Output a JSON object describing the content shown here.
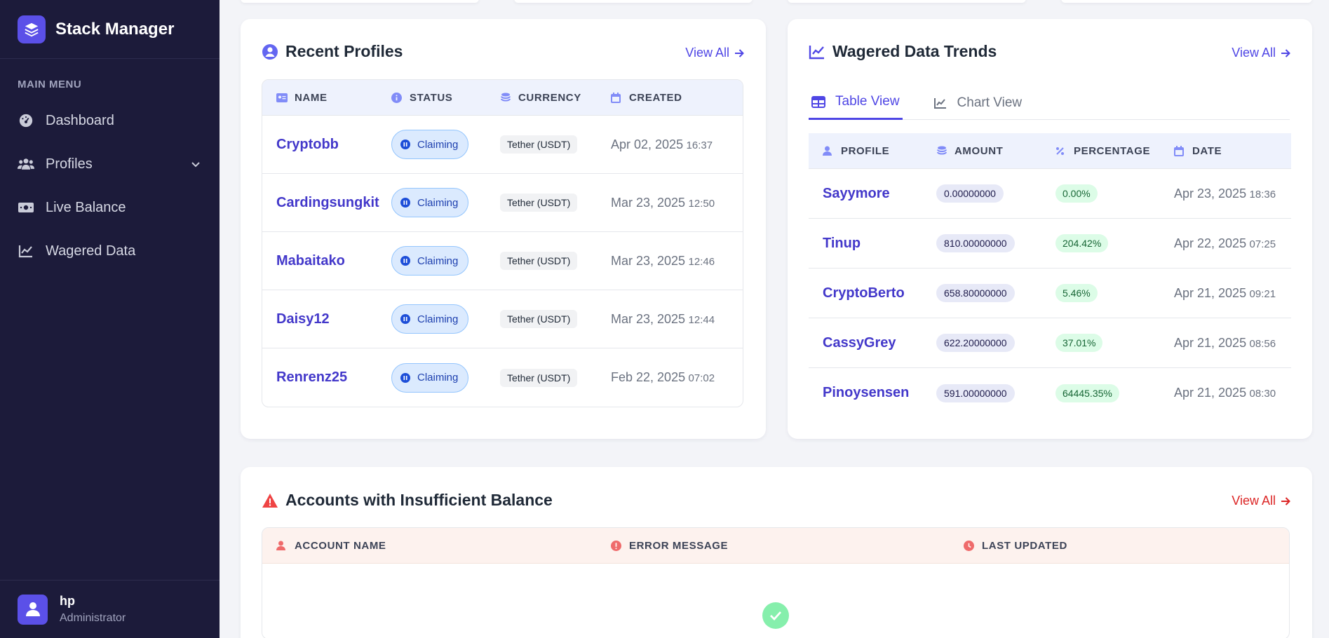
{
  "app": {
    "name": "Stack Manager"
  },
  "sidebar": {
    "menu_heading": "MAIN MENU",
    "items": [
      {
        "label": "Dashboard",
        "icon": "gauge-icon"
      },
      {
        "label": "Profiles",
        "icon": "users-icon"
      },
      {
        "label": "Live Balance",
        "icon": "money-bill-icon"
      },
      {
        "label": "Wagered Data",
        "icon": "chart-line-icon"
      }
    ],
    "user": {
      "name": "hp",
      "role": "Administrator"
    }
  },
  "recent_profiles": {
    "title": "Recent Profiles",
    "view_all": "View All",
    "columns": [
      "NAME",
      "STATUS",
      "CURRENCY",
      "CREATED"
    ],
    "rows": [
      {
        "name": "Cryptobb",
        "status": "Claiming",
        "currency": "Tether (USDT)",
        "date": "Apr 02, 2025",
        "time": "16:37"
      },
      {
        "name": "Cardingsungkit",
        "status": "Claiming",
        "currency": "Tether (USDT)",
        "date": "Mar 23, 2025",
        "time": "12:50"
      },
      {
        "name": "Mabaitako",
        "status": "Claiming",
        "currency": "Tether (USDT)",
        "date": "Mar 23, 2025",
        "time": "12:46"
      },
      {
        "name": "Daisy12",
        "status": "Claiming",
        "currency": "Tether (USDT)",
        "date": "Mar 23, 2025",
        "time": "12:44"
      },
      {
        "name": "Renrenz25",
        "status": "Claiming",
        "currency": "Tether (USDT)",
        "date": "Feb 22, 2025",
        "time": "07:02"
      }
    ]
  },
  "wagered": {
    "title": "Wagered Data Trends",
    "view_all": "View All",
    "tabs": [
      "Table View",
      "Chart View"
    ],
    "active_tab": "Table View",
    "columns": [
      "PROFILE",
      "AMOUNT",
      "PERCENTAGE",
      "DATE"
    ],
    "rows": [
      {
        "profile": "Sayymore",
        "amount": "0.00000000",
        "percentage": "0.00%",
        "date": "Apr 23, 2025",
        "time": "18:36"
      },
      {
        "profile": "Tinup",
        "amount": "810.00000000",
        "percentage": "204.42%",
        "date": "Apr 22, 2025",
        "time": "07:25"
      },
      {
        "profile": "CryptoBerto",
        "amount": "658.80000000",
        "percentage": "5.46%",
        "date": "Apr 21, 2025",
        "time": "09:21"
      },
      {
        "profile": "CassyGrey",
        "amount": "622.20000000",
        "percentage": "37.01%",
        "date": "Apr 21, 2025",
        "time": "08:56"
      },
      {
        "profile": "Pinoysensen",
        "amount": "591.00000000",
        "percentage": "64445.35%",
        "date": "Apr 21, 2025",
        "time": "08:30"
      }
    ]
  },
  "insufficient": {
    "title": "Accounts with Insufficient Balance",
    "view_all": "View All",
    "columns": [
      "ACCOUNT NAME",
      "ERROR MESSAGE",
      "LAST UPDATED"
    ]
  },
  "colors": {
    "sidebar_bg": "#1c1b3a",
    "accent": "#4f46e5",
    "danger": "#dc2626",
    "success": "#86efac"
  }
}
